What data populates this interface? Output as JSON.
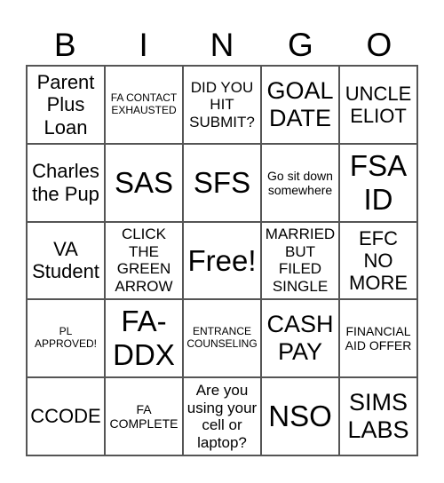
{
  "header": {
    "letters": [
      "B",
      "I",
      "N",
      "G",
      "O"
    ]
  },
  "cells": [
    [
      "Parent Plus Loan",
      "FA CONTACT EXHAUSTED",
      "DID YOU HIT SUBMIT?",
      "GOAL DATE",
      "UNCLE ELIOT"
    ],
    [
      "Charles the Pup",
      "SAS",
      "SFS",
      "Go sit down somewhere",
      "FSA ID"
    ],
    [
      "VA Student",
      "CLICK THE GREEN ARROW",
      "Free!",
      "MARRIED BUT FILED SINGLE",
      "EFC NO MORE"
    ],
    [
      "PL APPROVED!",
      "FA-DDX",
      "ENTRANCE COUNSELING",
      "CASH PAY",
      "FINANCIAL AID OFFER"
    ],
    [
      "CCODE",
      "FA COMPLETE",
      "Are you using your cell or laptop?",
      "NSO",
      "SIMS LABS"
    ]
  ]
}
